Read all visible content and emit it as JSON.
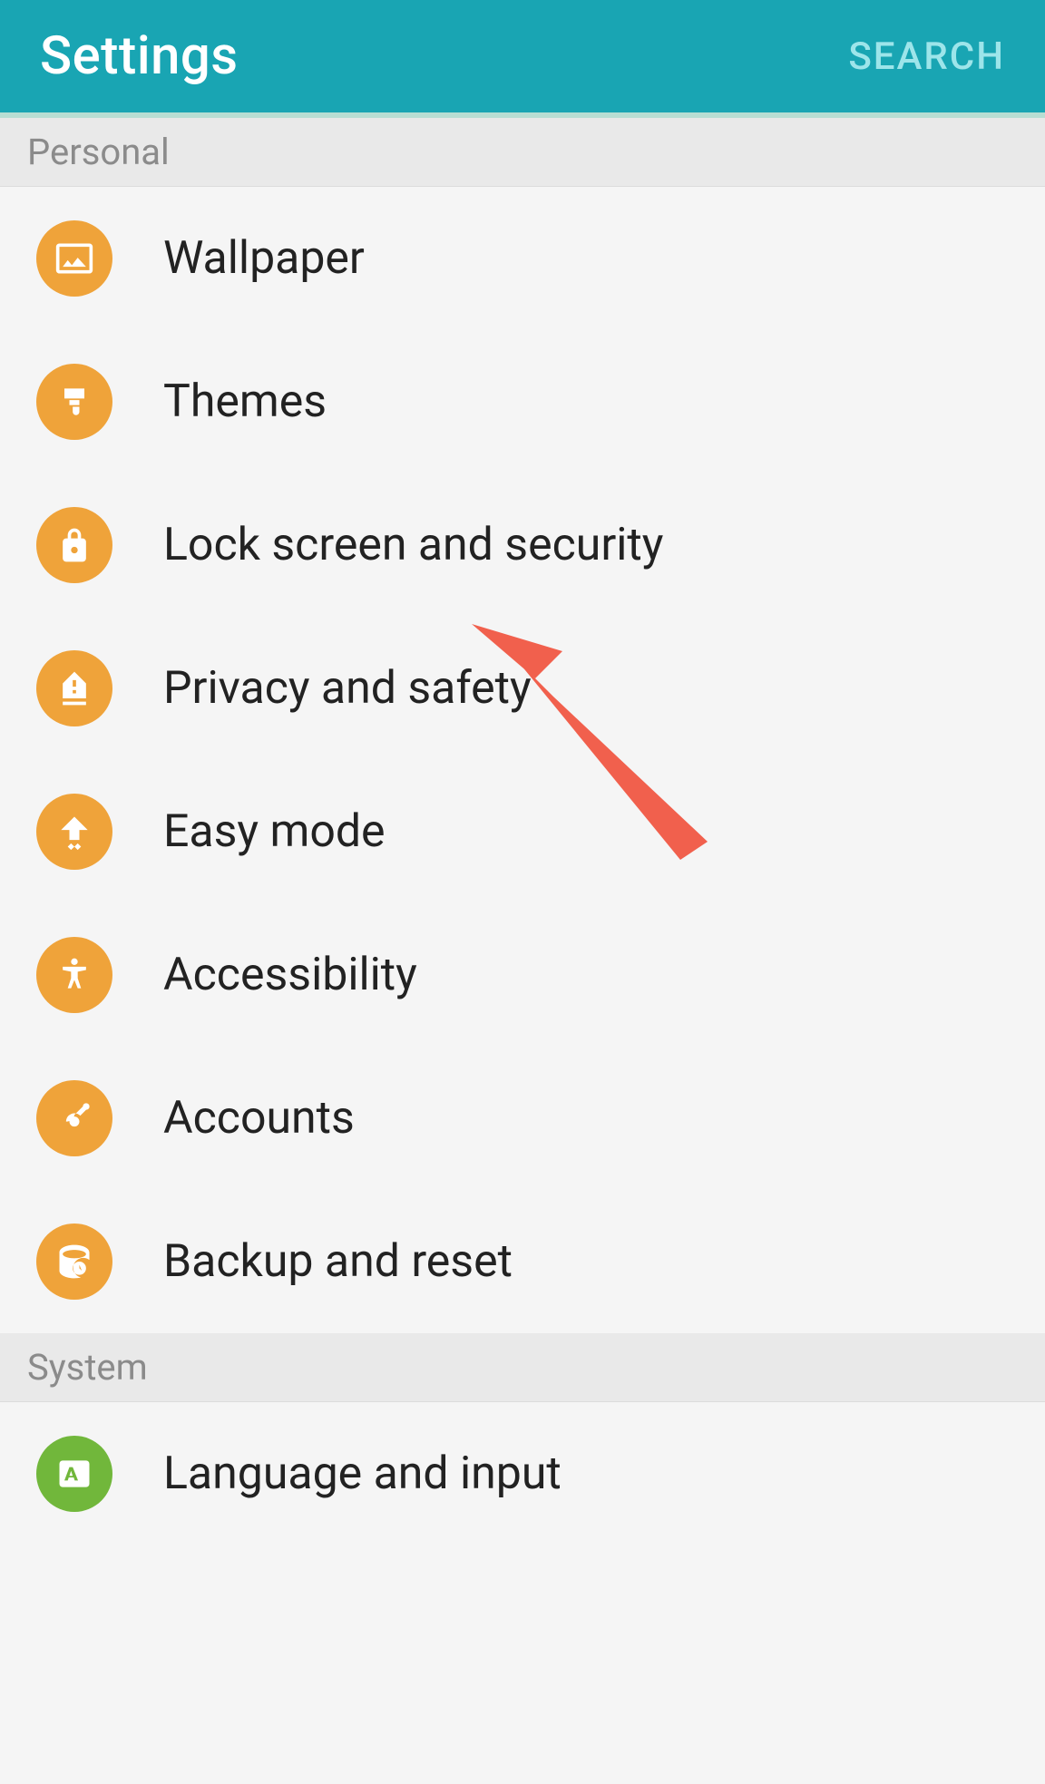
{
  "header": {
    "title": "Settings",
    "search_label": "SEARCH"
  },
  "sections": {
    "personal": {
      "label": "Personal",
      "items": [
        {
          "label": "Wallpaper"
        },
        {
          "label": "Themes"
        },
        {
          "label": "Lock screen and security"
        },
        {
          "label": "Privacy and safety"
        },
        {
          "label": "Easy mode"
        },
        {
          "label": "Accessibility"
        },
        {
          "label": "Accounts"
        },
        {
          "label": "Backup and reset"
        }
      ]
    },
    "system": {
      "label": "System",
      "items": [
        {
          "label": "Language and input"
        }
      ]
    }
  }
}
